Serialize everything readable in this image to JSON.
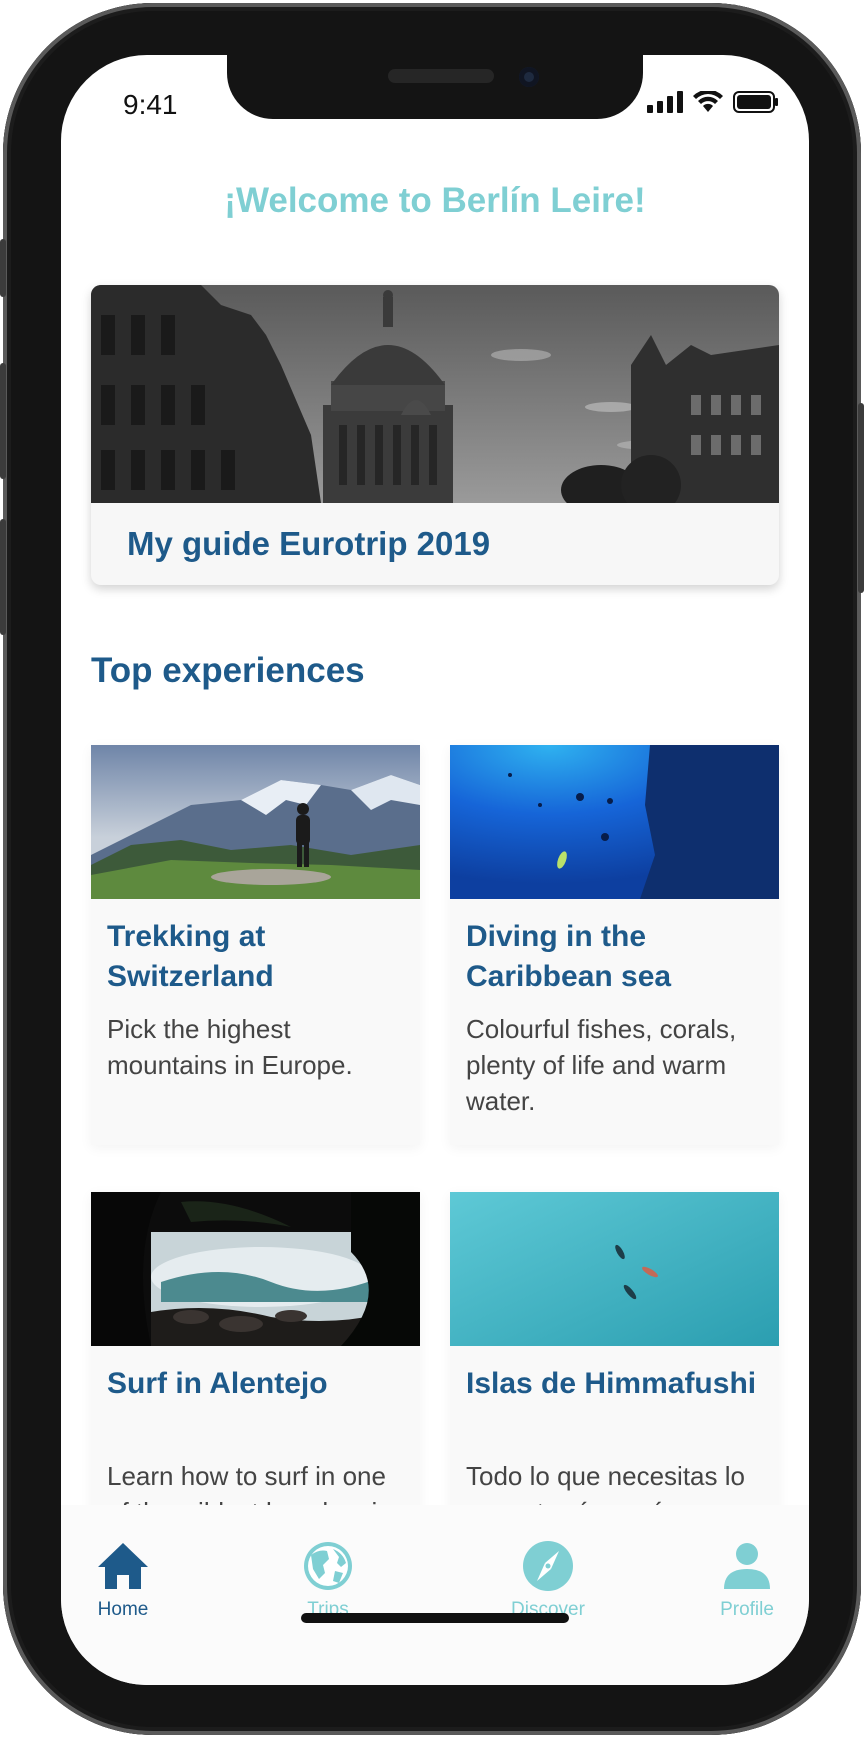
{
  "status_bar": {
    "time": "9:41"
  },
  "header": {
    "welcome": "¡Welcome to Berlín Leire!"
  },
  "guide": {
    "title": "My guide Eurotrip 2019"
  },
  "section": {
    "title": "Top experiences"
  },
  "experiences": [
    {
      "title": "Trekking at Switzerland",
      "description": "Pick the highest mountains in Europe."
    },
    {
      "title": "Diving in the Caribbean sea",
      "description": "Colourful fishes, corals, plenty of life and warm water."
    },
    {
      "title": "Surf in Alentejo",
      "description": "Learn how to surf in one of the wildest beaches in"
    },
    {
      "title": "Islas de Himmafushi",
      "description": "Todo lo que necesitas lo encontrarás aquí."
    }
  ],
  "tabs": [
    {
      "label": "Home",
      "icon": "home-icon",
      "active": true
    },
    {
      "label": "Trips",
      "icon": "globe-icon",
      "active": false
    },
    {
      "label": "Discover",
      "icon": "compass-icon",
      "active": false
    },
    {
      "label": "Profile",
      "icon": "person-icon",
      "active": false
    }
  ],
  "colors": {
    "accent": "#7fcfd3",
    "primary": "#1e5a8a",
    "text": "#444444",
    "tab_inactive": "#7fcfd3",
    "tab_active": "#1e5a8a"
  }
}
